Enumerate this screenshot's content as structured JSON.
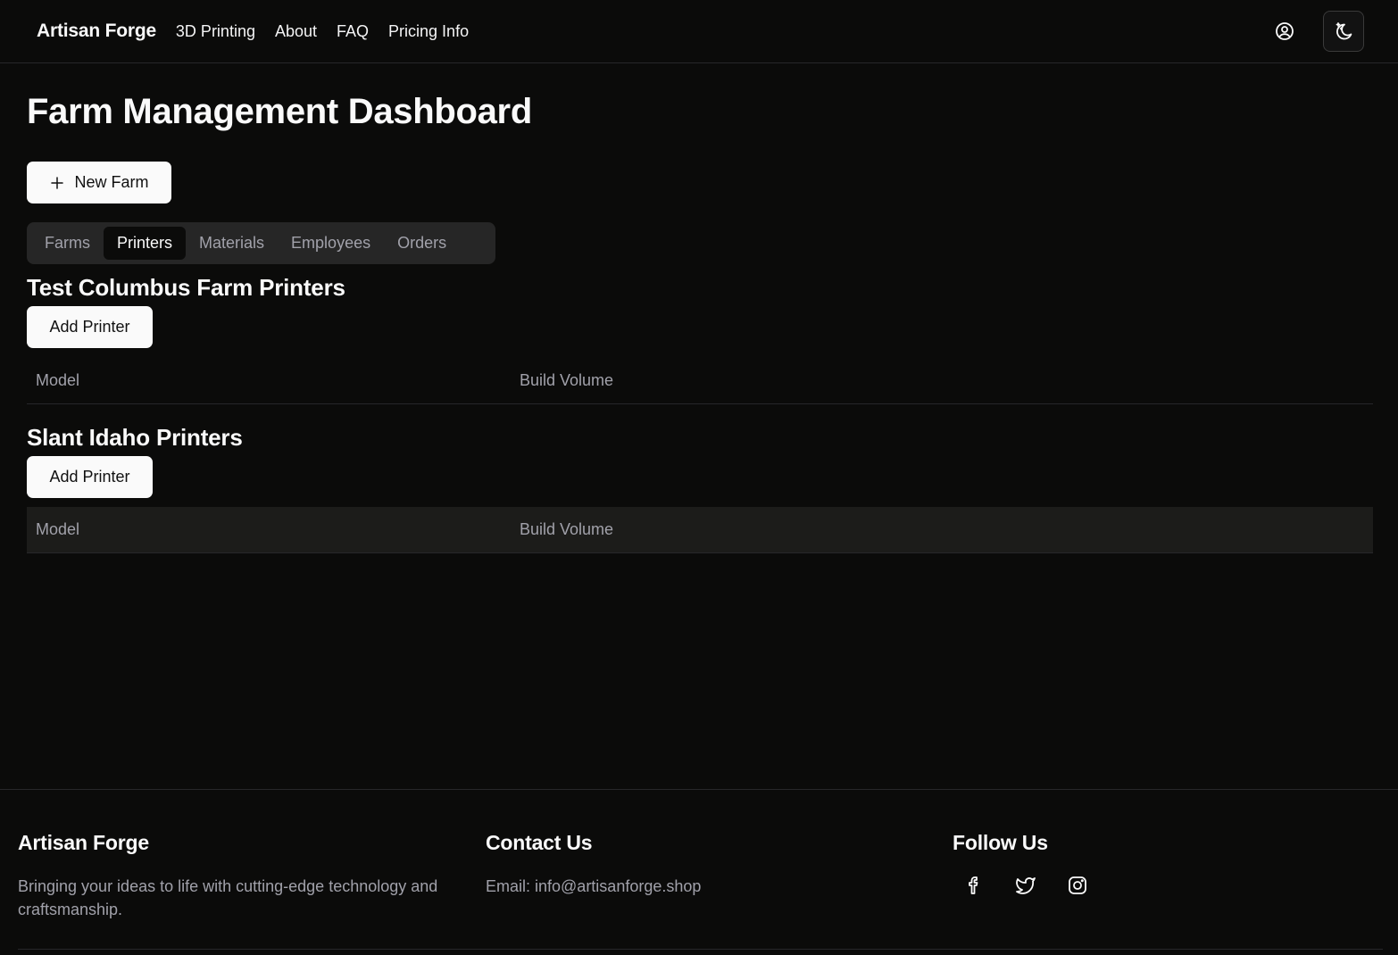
{
  "header": {
    "brand": "Artisan Forge",
    "nav": [
      "3D Printing",
      "About",
      "FAQ",
      "Pricing Info"
    ],
    "icons": [
      "user-circle-icon",
      "moon-stars-icon"
    ]
  },
  "main": {
    "title": "Farm Management Dashboard",
    "new_farm_label": "New Farm",
    "tabs": [
      {
        "label": "Farms",
        "active": false
      },
      {
        "label": "Printers",
        "active": true
      },
      {
        "label": "Materials",
        "active": false
      },
      {
        "label": "Employees",
        "active": false
      },
      {
        "label": "Orders",
        "active": false
      }
    ],
    "sections": [
      {
        "title": "Test Columbus Farm Printers",
        "button": "Add Printer",
        "columns": [
          "Model",
          "Build Volume"
        ]
      },
      {
        "title": "Slant Idaho Printers",
        "button": "Add Printer",
        "columns": [
          "Model",
          "Build Volume"
        ]
      }
    ]
  },
  "footer": {
    "brand": {
      "title": "Artisan Forge",
      "text": "Bringing your ideas to life with cutting-edge technology and craftsmanship."
    },
    "contact": {
      "title": "Contact Us",
      "email": "Email: info@artisanforge.shop"
    },
    "follow": {
      "title": "Follow Us",
      "icons": [
        "facebook-icon",
        "twitter-icon",
        "instagram-icon"
      ]
    }
  },
  "colors": {
    "background": "#0b0b0a",
    "foreground": "#fafafa",
    "muted": "#a1a1aa",
    "border": "#27272a",
    "tab_track": "#262626"
  }
}
